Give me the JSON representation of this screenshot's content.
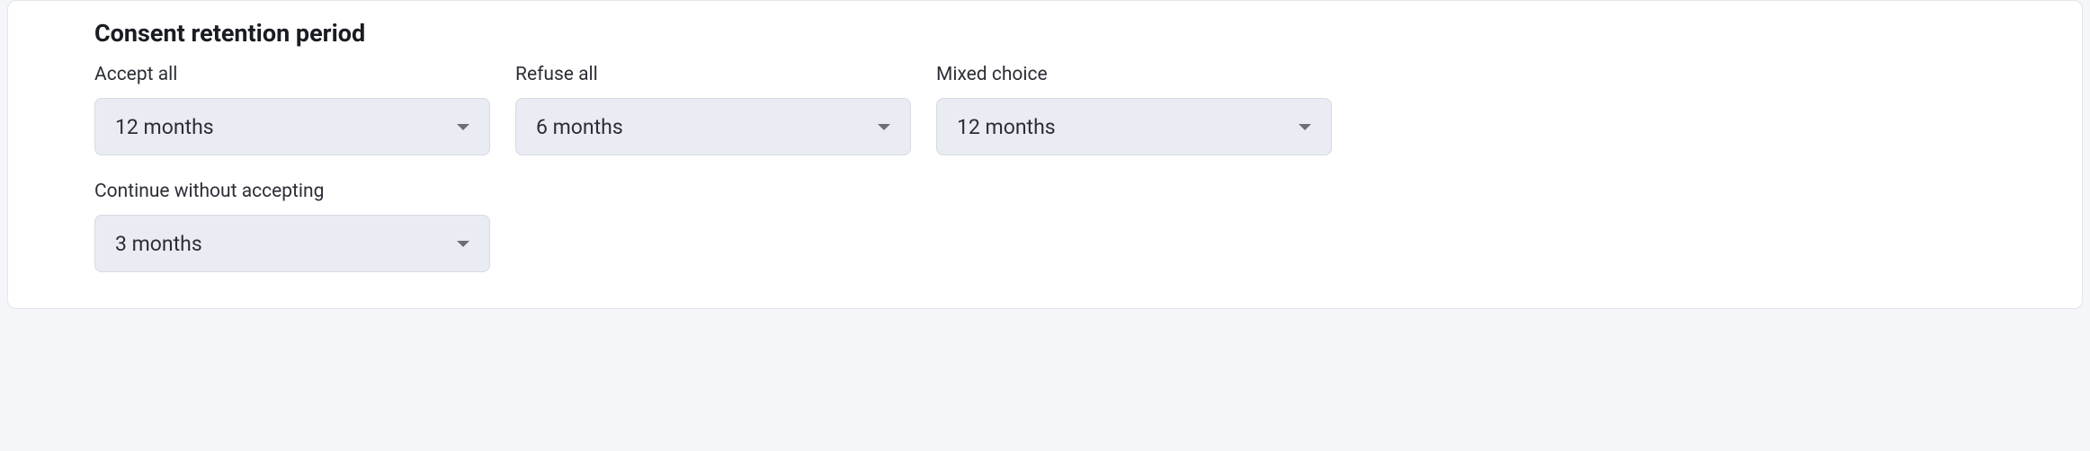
{
  "section": {
    "title": "Consent retention period"
  },
  "fields": {
    "accept_all": {
      "label": "Accept all",
      "value": "12 months"
    },
    "refuse_all": {
      "label": "Refuse all",
      "value": "6 months"
    },
    "mixed_choice": {
      "label": "Mixed choice",
      "value": "12 months"
    },
    "continue_without_accepting": {
      "label": "Continue without accepting",
      "value": "3 months"
    }
  }
}
